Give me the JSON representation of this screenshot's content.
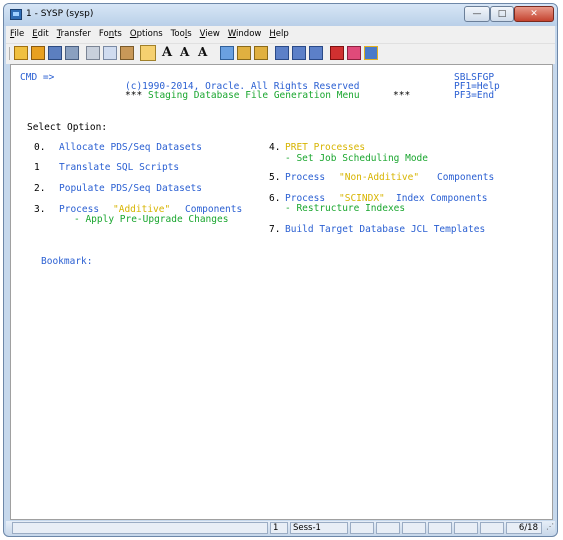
{
  "window": {
    "title": "1 - SYSP (sysp)"
  },
  "menu": [
    {
      "pre": "",
      "u": "F",
      "post": "ile"
    },
    {
      "pre": "",
      "u": "E",
      "post": "dit"
    },
    {
      "pre": "",
      "u": "T",
      "post": "ransfer"
    },
    {
      "pre": "Fo",
      "u": "n",
      "post": "ts"
    },
    {
      "pre": "",
      "u": "O",
      "post": "ptions"
    },
    {
      "pre": "Too",
      "u": "l",
      "post": "s"
    },
    {
      "pre": "",
      "u": "V",
      "post": "iew"
    },
    {
      "pre": "",
      "u": "W",
      "post": "indow"
    },
    {
      "pre": "",
      "u": "H",
      "post": "elp"
    }
  ],
  "toolbar": {
    "font_a1": "A",
    "font_a2": "A",
    "font_a3": "A"
  },
  "terminal": {
    "cmd": "CMD =>",
    "copyright": "(c)1990-2014, Oracle. All Rights Reserved",
    "menu_prefix": "***",
    "menu_title": "Staging Database File Generation Menu",
    "menu_suffix": "***",
    "panel_id": "SBLSFGP",
    "pf1": "PF1=Help",
    "pf3": "PF3=End",
    "select_option": "Select Option:",
    "options": {
      "o0": {
        "num": "0.",
        "label": "Allocate PDS/Seq Datasets"
      },
      "o1": {
        "num": "1",
        "label": "Translate SQL Scripts"
      },
      "o2": {
        "num": "2.",
        "label": "Populate PDS/Seq Datasets"
      },
      "o3": {
        "num": "3.",
        "label_a": "Process",
        "label_b": "\"Additive\"",
        "label_c": "Components",
        "sub": "- Apply Pre-Upgrade Changes"
      },
      "o4": {
        "num": "4.",
        "label": "PRET Processes",
        "sub": "- Set Job Scheduling Mode"
      },
      "o5": {
        "num": "5.",
        "label_a": "Process",
        "label_b": "\"Non-Additive\"",
        "label_c": "Components"
      },
      "o6": {
        "num": "6.",
        "label_a": "Process",
        "label_b": "\"SCINDX\"",
        "label_c": "Index Components",
        "sub": "- Restructure Indexes"
      },
      "o7": {
        "num": "7.",
        "label": "Build Target Database JCL Templates"
      }
    },
    "bookmark": "Bookmark:"
  },
  "status": {
    "session_num": "1",
    "session_name": "Sess-1",
    "position": "6/18"
  },
  "colors": {
    "blue": "#2a5fd2",
    "green": "#1aa62f",
    "yellow": "#d7b400"
  },
  "icons": [
    "new-session-icon",
    "open-icon",
    "save-icon",
    "print-icon",
    "cut-icon",
    "copy-icon",
    "paste-icon",
    "active-toggle-icon",
    "font-icon",
    "font-larger-icon",
    "font-smaller-icon",
    "transfer-icon",
    "send-icon",
    "receive-icon",
    "pf1-icon",
    "pf2-icon",
    "pf3-icon",
    "enter-icon",
    "check-icon",
    "exit-icon"
  ]
}
